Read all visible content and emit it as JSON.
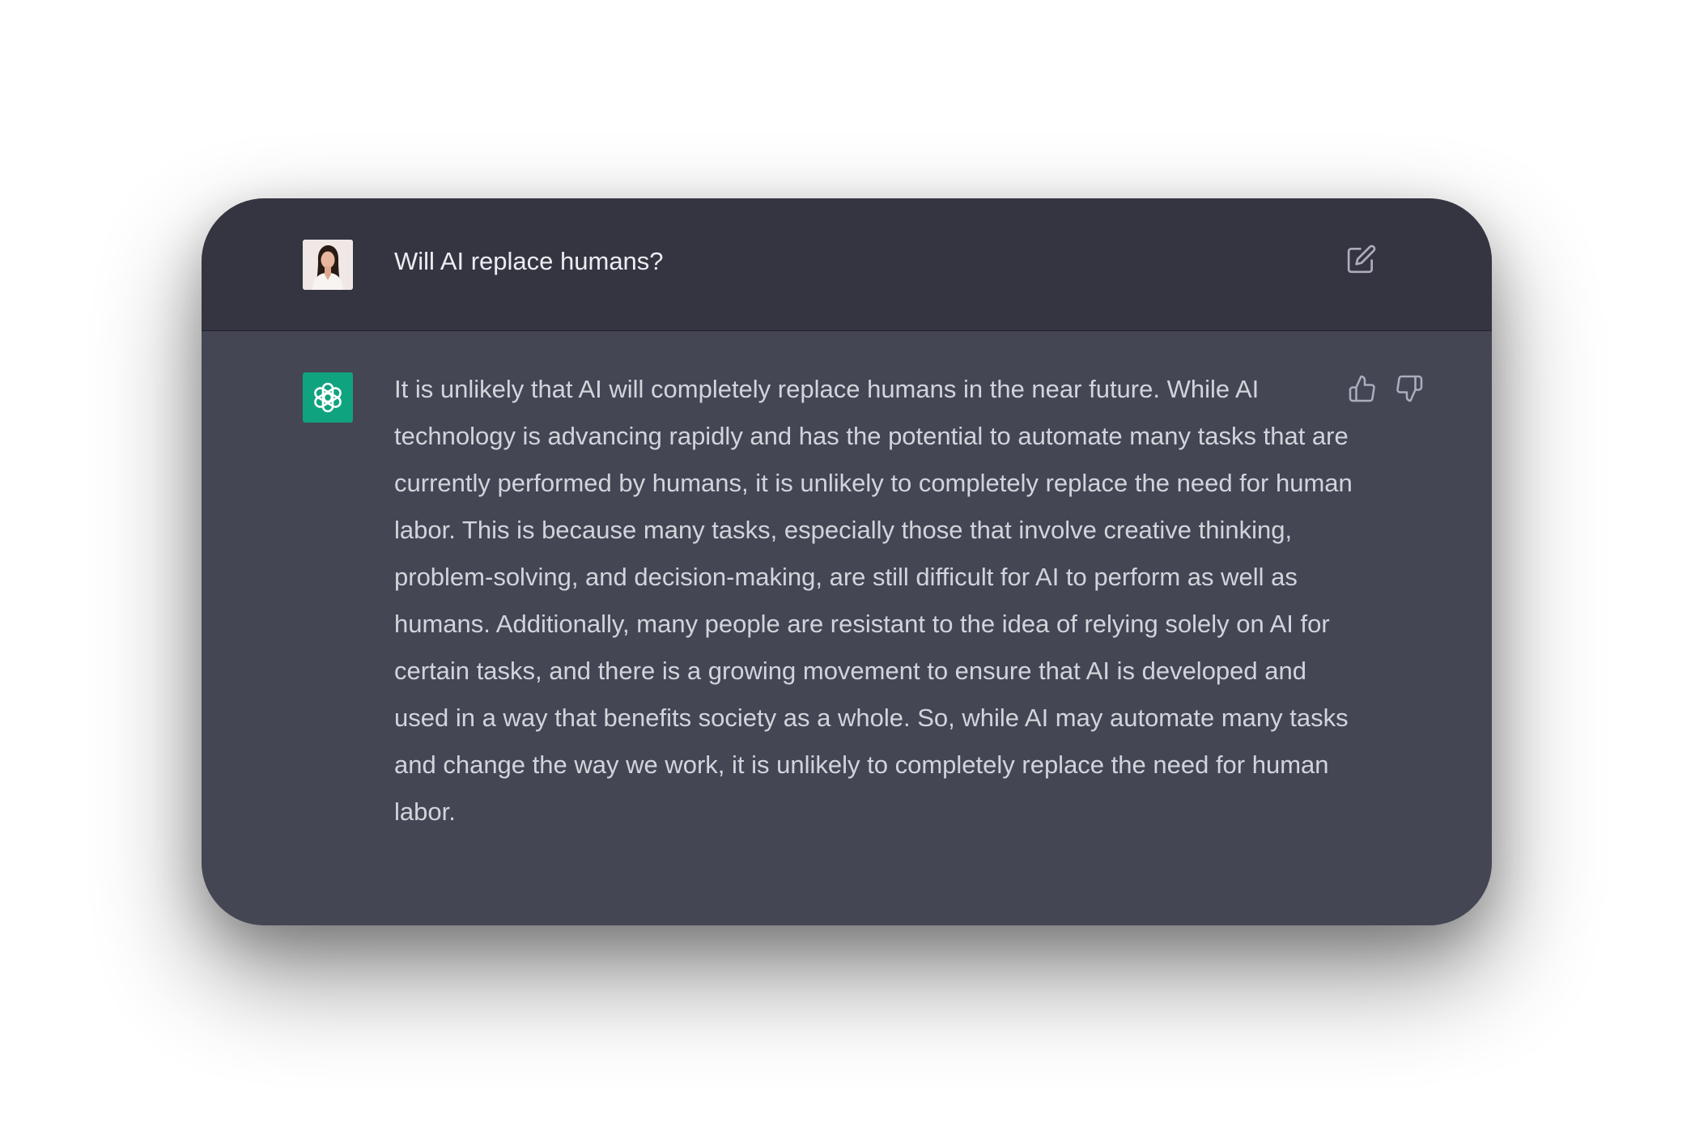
{
  "conversation": {
    "user_message": "Will AI replace humans?",
    "assistant_message": "It is unlikely that AI will completely replace humans in the near future. While AI technology is advancing rapidly and has the potential to automate many tasks that are currently performed by humans, it is unlikely to completely replace the need for human labor. This is because many tasks, especially those that involve creative thinking, problem-solving, and decision-making, are still difficult for AI to perform as well as humans. Additionally, many people are resistant to the idea of relying solely on AI for certain tasks, and there is a growing movement to ensure that AI is developed and used in a way that benefits society as a whole. So, while AI may automate many tasks and change the way we work, it is unlikely to completely replace the need for human labor."
  },
  "icons": {
    "user_avatar": "user-avatar-photo",
    "assistant_avatar": "chatgpt-logo-icon",
    "edit": "edit-icon",
    "thumbs_up": "thumbs-up-icon",
    "thumbs_down": "thumbs-down-icon"
  },
  "colors": {
    "user_row_bg": "#343541",
    "assistant_row_bg": "#444654",
    "assistant_avatar_bg": "#10a37f",
    "text": "#d1d5db"
  }
}
